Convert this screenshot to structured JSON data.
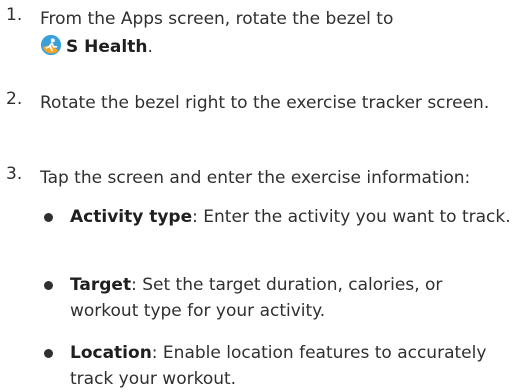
{
  "steps": [
    {
      "number": "1.",
      "text_before": "From the Apps screen, rotate the bezel to",
      "app_name": "S Health",
      "text_after": "."
    },
    {
      "number": "2.",
      "text": "Rotate the bezel right to the exercise tracker screen."
    },
    {
      "number": "3.",
      "text": "Tap the screen and enter the exercise information:"
    }
  ],
  "bullets": [
    {
      "term": "Activity type",
      "desc": ": Enter the activity you want to track."
    },
    {
      "term": "Target",
      "desc": ": Set the target duration, calories, or workout type for your activity."
    },
    {
      "term": "Location",
      "desc": ": Enable location features to accurately track your workout."
    }
  ],
  "icons": {
    "app_icon": "s-health-app-icon"
  }
}
